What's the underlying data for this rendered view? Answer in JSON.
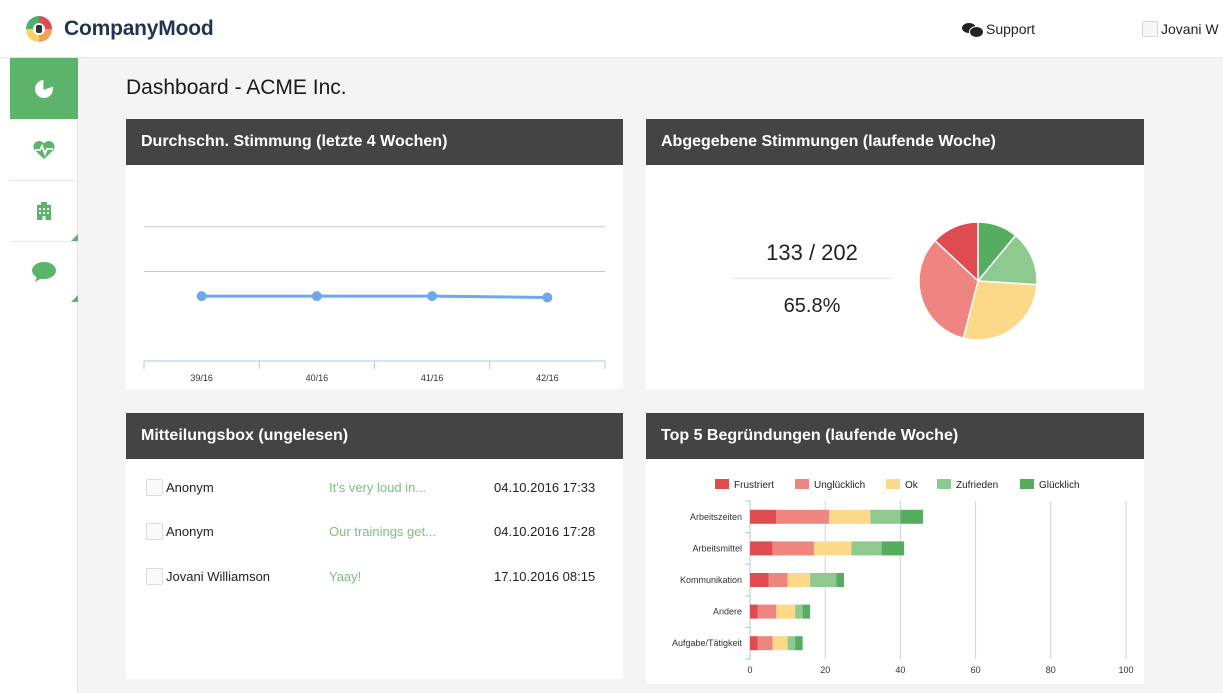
{
  "app": {
    "name": "CompanyMood",
    "support_label": "Support",
    "user_name": "Jovani W"
  },
  "sidebar": {
    "items": [
      {
        "icon": "pie-chart-icon",
        "active": true
      },
      {
        "icon": "heartbeat-icon",
        "active": false
      },
      {
        "icon": "building-icon",
        "active": false
      },
      {
        "icon": "chat-bubble-icon",
        "active": false
      }
    ]
  },
  "page": {
    "title": "Dashboard - ACME Inc."
  },
  "mood_chart": {
    "title": "Durchschn. Stimmung (letzte 4 Wochen)",
    "chart_data": {
      "type": "line",
      "categories": [
        "39/16",
        "40/16",
        "41/16",
        "42/16"
      ],
      "values": [
        2.45,
        2.45,
        2.45,
        2.42
      ],
      "ylim": [
        1,
        5
      ],
      "gridlines": [
        3,
        4
      ],
      "color": "#6fa8e8"
    }
  },
  "submitted": {
    "title": "Abgegebene Stimmungen (laufende Woche)",
    "count": "133 / 202",
    "percent": "65.8%",
    "chart_data": {
      "type": "pie",
      "labels": [
        "Frustriert",
        "Zufrieden",
        "Glücklich",
        "Ok",
        "Unglücklich"
      ],
      "values": [
        13,
        11,
        15,
        28,
        33
      ],
      "colors": [
        "#e04b52",
        "#56ad5f",
        "#8ec98f",
        "#fcd889",
        "#ee8580"
      ]
    }
  },
  "messages": {
    "title": "Mitteilungsbox (ungelesen)",
    "rows": [
      {
        "name": "Anonym",
        "text": "It's very loud in...",
        "date": "04.10.2016 17:33"
      },
      {
        "name": "Anonym",
        "text": "Our trainings get...",
        "date": "04.10.2016 17:28"
      },
      {
        "name": "Jovani Williamson",
        "text": "Yaay!",
        "date": "17.10.2016 08:15"
      }
    ]
  },
  "reasons": {
    "title": "Top 5 Begründungen (laufende Woche)",
    "chart_data": {
      "type": "bar",
      "orientation": "horizontal",
      "stacked": true,
      "categories": [
        "Arbeitszeiten",
        "Arbeitsmittel",
        "Kommunikation",
        "Andere",
        "Aufgabe/Tätigkeit"
      ],
      "series": [
        {
          "name": "Frustriert",
          "color": "#e04b52",
          "values": [
            7,
            6,
            5,
            2,
            2
          ]
        },
        {
          "name": "Unglücklich",
          "color": "#ee8580",
          "values": [
            14,
            11,
            5,
            5,
            4
          ]
        },
        {
          "name": "Ok",
          "color": "#fcd889",
          "values": [
            11,
            10,
            6,
            5,
            4
          ]
        },
        {
          "name": "Zufrieden",
          "color": "#8ec98f",
          "values": [
            8,
            8,
            7,
            2,
            2
          ]
        },
        {
          "name": "Glücklich",
          "color": "#56ad5f",
          "values": [
            6,
            6,
            2,
            2,
            2
          ]
        }
      ],
      "xlim": [
        0,
        100
      ],
      "xticks": [
        0,
        20,
        40,
        60,
        80,
        100
      ],
      "legend": "top"
    }
  }
}
